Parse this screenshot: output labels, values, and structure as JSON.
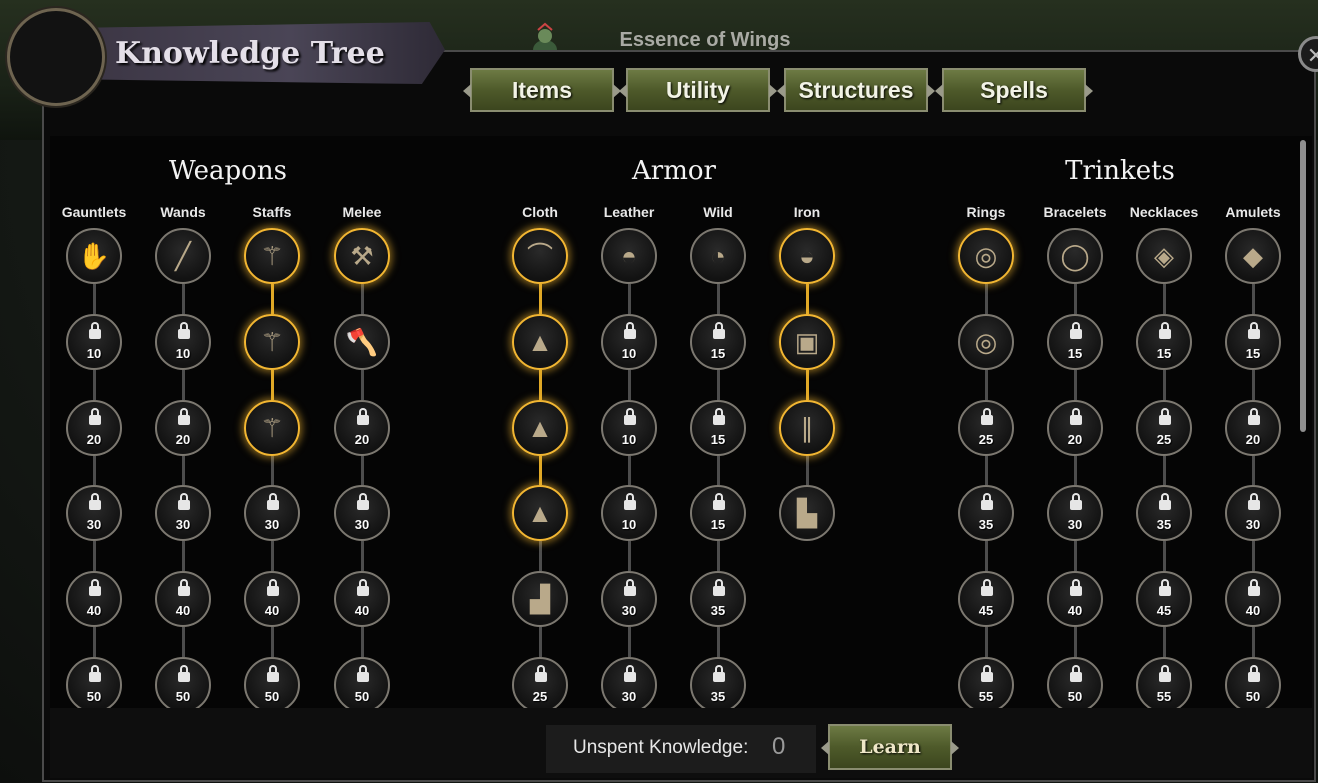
{
  "header": {
    "title": "Knowledge Tree",
    "essence_label": "Essence of Wings",
    "close_label": "✕"
  },
  "tabs": [
    {
      "label": "Items"
    },
    {
      "label": "Utility"
    },
    {
      "label": "Structures"
    },
    {
      "label": "Spells"
    }
  ],
  "sections": [
    {
      "title": "Weapons",
      "columns": [
        {
          "label": "Gauntlets",
          "nodes": [
            {
              "state": "unlocked",
              "icon": "gauntlet-icon"
            },
            {
              "state": "locked",
              "cost": "10"
            },
            {
              "state": "locked",
              "cost": "20"
            },
            {
              "state": "locked",
              "cost": "30"
            },
            {
              "state": "locked",
              "cost": "40"
            },
            {
              "state": "locked",
              "cost": "50"
            }
          ]
        },
        {
          "label": "Wands",
          "nodes": [
            {
              "state": "unlocked",
              "icon": "wand-icon"
            },
            {
              "state": "locked",
              "cost": "10"
            },
            {
              "state": "locked",
              "cost": "20"
            },
            {
              "state": "locked",
              "cost": "30"
            },
            {
              "state": "locked",
              "cost": "40"
            },
            {
              "state": "locked",
              "cost": "50"
            }
          ]
        },
        {
          "label": "Staffs",
          "nodes": [
            {
              "state": "active",
              "icon": "staff-icon"
            },
            {
              "state": "active",
              "icon": "staff-icon"
            },
            {
              "state": "active",
              "icon": "staff-icon"
            },
            {
              "state": "locked",
              "cost": "30"
            },
            {
              "state": "locked",
              "cost": "40"
            },
            {
              "state": "locked",
              "cost": "50"
            }
          ]
        },
        {
          "label": "Melee",
          "nodes": [
            {
              "state": "active",
              "icon": "hammer-icon"
            },
            {
              "state": "unlocked",
              "icon": "axe-icon"
            },
            {
              "state": "locked",
              "cost": "20"
            },
            {
              "state": "locked",
              "cost": "30"
            },
            {
              "state": "locked",
              "cost": "40"
            },
            {
              "state": "locked",
              "cost": "50"
            }
          ]
        }
      ]
    },
    {
      "title": "Armor",
      "columns": [
        {
          "label": "Cloth",
          "nodes": [
            {
              "state": "active",
              "icon": "hat-icon"
            },
            {
              "state": "active",
              "icon": "robe-icon"
            },
            {
              "state": "active",
              "icon": "wizard-hat-icon"
            },
            {
              "state": "active",
              "icon": "robe-icon"
            },
            {
              "state": "unlocked",
              "icon": "boots-icon"
            },
            {
              "state": "locked",
              "cost": "25"
            }
          ]
        },
        {
          "label": "Leather",
          "nodes": [
            {
              "state": "unlocked",
              "icon": "helmet-icon"
            },
            {
              "state": "locked",
              "cost": "10"
            },
            {
              "state": "locked",
              "cost": "10"
            },
            {
              "state": "locked",
              "cost": "10"
            },
            {
              "state": "locked",
              "cost": "30"
            },
            {
              "state": "locked",
              "cost": "30"
            }
          ]
        },
        {
          "label": "Wild",
          "nodes": [
            {
              "state": "unlocked",
              "icon": "plague-mask-icon"
            },
            {
              "state": "locked",
              "cost": "15"
            },
            {
              "state": "locked",
              "cost": "15"
            },
            {
              "state": "locked",
              "cost": "15"
            },
            {
              "state": "locked",
              "cost": "35"
            },
            {
              "state": "locked",
              "cost": "35"
            }
          ]
        },
        {
          "label": "Iron",
          "nodes": [
            {
              "state": "active",
              "icon": "iron-helmet-icon"
            },
            {
              "state": "active",
              "icon": "chestplate-icon"
            },
            {
              "state": "active",
              "icon": "greaves-icon"
            },
            {
              "state": "unlocked",
              "icon": "iron-boots-icon"
            }
          ]
        }
      ]
    },
    {
      "title": "Trinkets",
      "columns": [
        {
          "label": "Rings",
          "nodes": [
            {
              "state": "active",
              "icon": "ring-icon"
            },
            {
              "state": "unlocked",
              "icon": "ring-icon"
            },
            {
              "state": "locked",
              "cost": "25"
            },
            {
              "state": "locked",
              "cost": "35"
            },
            {
              "state": "locked",
              "cost": "45"
            },
            {
              "state": "locked",
              "cost": "55"
            }
          ]
        },
        {
          "label": "Bracelets",
          "nodes": [
            {
              "state": "unlocked",
              "icon": "bracelet-icon"
            },
            {
              "state": "locked",
              "cost": "15"
            },
            {
              "state": "locked",
              "cost": "20"
            },
            {
              "state": "locked",
              "cost": "30"
            },
            {
              "state": "locked",
              "cost": "40"
            },
            {
              "state": "locked",
              "cost": "50"
            }
          ]
        },
        {
          "label": "Necklaces",
          "nodes": [
            {
              "state": "unlocked",
              "icon": "necklace-icon"
            },
            {
              "state": "locked",
              "cost": "15"
            },
            {
              "state": "locked",
              "cost": "25"
            },
            {
              "state": "locked",
              "cost": "35"
            },
            {
              "state": "locked",
              "cost": "45"
            },
            {
              "state": "locked",
              "cost": "55"
            }
          ]
        },
        {
          "label": "Amulets",
          "nodes": [
            {
              "state": "unlocked",
              "icon": "amulet-icon"
            },
            {
              "state": "locked",
              "cost": "15"
            },
            {
              "state": "locked",
              "cost": "20"
            },
            {
              "state": "locked",
              "cost": "30"
            },
            {
              "state": "locked",
              "cost": "40"
            },
            {
              "state": "locked",
              "cost": "50"
            }
          ]
        }
      ]
    }
  ],
  "footer": {
    "unspent_label": "Unspent Knowledge:",
    "unspent_value": "0",
    "learn_label": "Learn"
  },
  "colors": {
    "active_border": "#f2b632",
    "tab_green": "#4e5a2a"
  }
}
